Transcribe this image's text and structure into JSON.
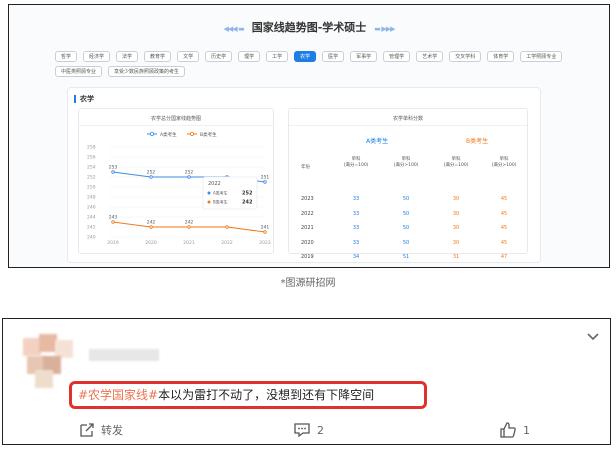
{
  "panel": {
    "title": "国家线趋势图-学术硕士",
    "tabs": [
      "哲学",
      "经济学",
      "法学",
      "教育学",
      "文学",
      "历史学",
      "理学",
      "工学",
      "农学",
      "医学",
      "军事学",
      "管理学",
      "艺术学",
      "交叉学科",
      "体育学",
      "工学照顾专业",
      "中医类照顾专业",
      "享受少数民族照顾政策的考生"
    ],
    "active_tab": "农学",
    "section_title": "农学",
    "chart_title": "农学总分国家线趋势图",
    "table_title": "农学单科分数",
    "table": {
      "a_label": "A类考生",
      "b_label": "B类考生",
      "head_year": "年份",
      "head_cols": [
        "单科\n(满分=100)",
        "单科\n(满分>100)",
        "单科\n(满分=100)",
        "单科\n(满分>100)"
      ],
      "rows": [
        {
          "year": "2023",
          "a1": "33",
          "a2": "50",
          "b1": "30",
          "b2": "45"
        },
        {
          "year": "2022",
          "a1": "33",
          "a2": "50",
          "b1": "30",
          "b2": "45"
        },
        {
          "year": "2021",
          "a1": "33",
          "a2": "50",
          "b1": "30",
          "b2": "45"
        },
        {
          "year": "2020",
          "a1": "33",
          "a2": "50",
          "b1": "30",
          "b2": "45"
        },
        {
          "year": "2019",
          "a1": "34",
          "a2": "51",
          "b1": "31",
          "b2": "47"
        }
      ]
    }
  },
  "chart_data": {
    "type": "line",
    "title": "农学总分国家线趋势图",
    "x": [
      "2019",
      "2020",
      "2021",
      "2022",
      "2023"
    ],
    "series": [
      {
        "name": "A类考生",
        "values": [
          253,
          252,
          252,
          252,
          251
        ],
        "color": "#3a8ee6"
      },
      {
        "name": "B类考生",
        "values": [
          243,
          242,
          242,
          242,
          241
        ],
        "color": "#f07a18"
      }
    ],
    "y_ticks": [
      "258",
      "256",
      "254",
      "252",
      "250",
      "248",
      "246",
      "244",
      "242",
      "240"
    ],
    "ylim": [
      240,
      258
    ],
    "legend": "top-center",
    "grid": true,
    "tooltip": {
      "year": "2022",
      "a_label": "A类考生",
      "a_value": "252",
      "b_label": "B类考生",
      "b_value": "242"
    }
  },
  "caption": "*图源研招网",
  "comment": {
    "hashtag": "#农学国家线#",
    "text": "本以为雷打不动了，没想到还有下降空间",
    "actions": {
      "repost_label": "转发",
      "comment_count": "2",
      "like_count": "1"
    }
  },
  "colors": {
    "accent": "#1f7de6",
    "orange": "#f07a18",
    "highlight": "#e0322c"
  }
}
